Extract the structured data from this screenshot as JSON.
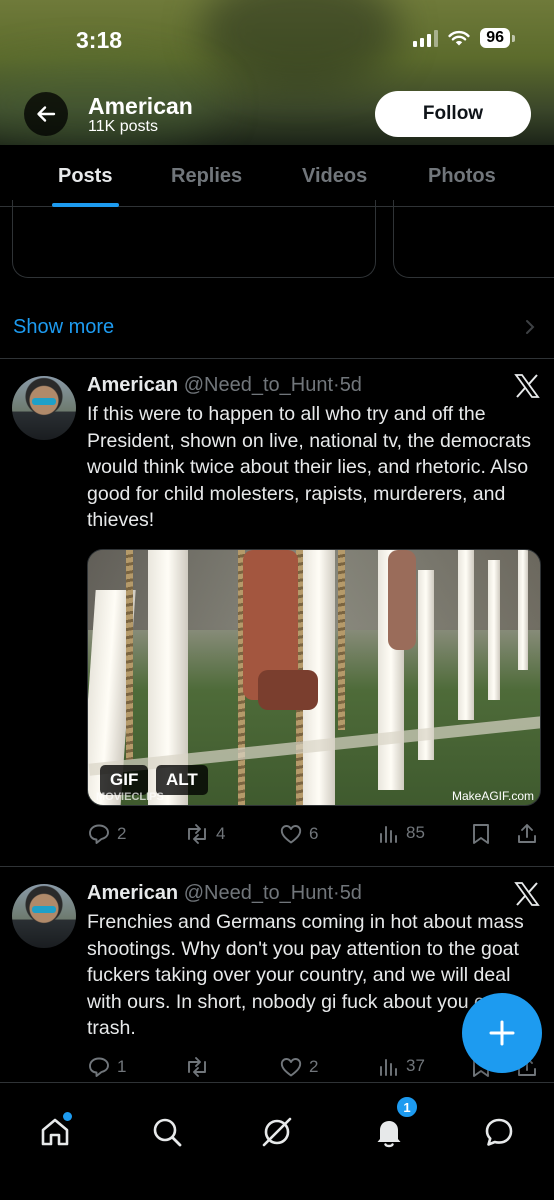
{
  "status_bar": {
    "time": "3:18",
    "battery": "96"
  },
  "profile": {
    "name": "American",
    "posts_count": "11K posts",
    "follow_label": "Follow"
  },
  "tabs": [
    {
      "label": "Posts",
      "active": true
    },
    {
      "label": "Replies",
      "active": false
    },
    {
      "label": "Videos",
      "active": false
    },
    {
      "label": "Photos",
      "active": false
    }
  ],
  "show_more": "Show more",
  "tweets": [
    {
      "name": "American",
      "handle": "@Need_to_Hunt",
      "separator": "·",
      "time": "5d",
      "text": "If this were to happen to all who try and off the President, shown on live, national tv, the democrats would think twice about their lies, and rhetoric. Also good for child molesters, rapists, murderers, and thieves!",
      "media": {
        "badge_gif": "GIF",
        "badge_alt": "ALT",
        "watermark": "MakeAGIF.com",
        "watermark_left": "MOVIECLIPS"
      },
      "replies": "2",
      "reposts": "4",
      "likes": "6",
      "views": "85"
    },
    {
      "name": "American",
      "handle": "@Need_to_Hunt",
      "separator": "·",
      "time": "5d",
      "text": "Frenchies and Germans coming in hot about mass shootings.  Why don't you pay attention to the goat fuckers taking over your country, and we will deal with ours.  In short, nobody gi fuck about you euro trash.",
      "replies": "1",
      "reposts": "",
      "likes": "2",
      "views": "37"
    }
  ],
  "bottom_nav": {
    "notifications_count": "1"
  },
  "icons": [
    "back-arrow-icon",
    "x-logo-icon",
    "reply-icon",
    "repost-icon",
    "like-icon",
    "views-icon",
    "bookmark-icon",
    "share-icon",
    "compose-icon",
    "home-icon",
    "search-icon",
    "grok-icon",
    "bell-icon",
    "messages-icon"
  ],
  "colors": {
    "accent": "#1d9bf0",
    "background": "#000000",
    "muted": "#71767b"
  }
}
